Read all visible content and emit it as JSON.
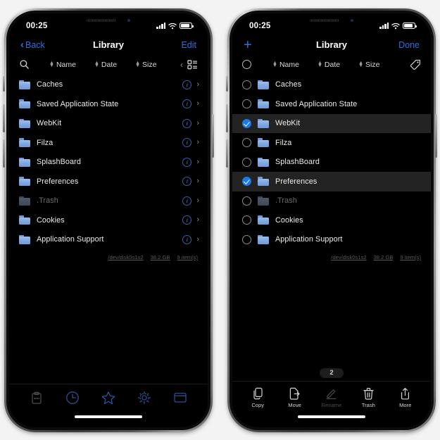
{
  "accent_blue": "#2f6fe0",
  "check_blue": "#1a7ae8",
  "folder_blue": "#7da7e0",
  "phones": [
    {
      "id": "browse-mode",
      "status": {
        "time": "00:25",
        "signal_icon": "cellular-bars-icon",
        "wifi_icon": "wifi-icon",
        "battery_icon": "battery-icon"
      },
      "nav": {
        "back_label": "Back",
        "title": "Library",
        "right_label": "Edit"
      },
      "toolbar": {
        "left_icon": "search-icon",
        "sorts": [
          {
            "label": "Name"
          },
          {
            "label": "Date"
          },
          {
            "label": "Size"
          }
        ],
        "right_chevron_icon": "chevron-left-icon",
        "right_icon": "list-view-icon"
      },
      "files": [
        {
          "name": "Caches",
          "dim": false,
          "selected": false
        },
        {
          "name": "Saved Application State",
          "dim": false,
          "selected": false
        },
        {
          "name": "WebKit",
          "dim": false,
          "selected": false
        },
        {
          "name": "Filza",
          "dim": false,
          "selected": false
        },
        {
          "name": "SplashBoard",
          "dim": false,
          "selected": false
        },
        {
          "name": "Preferences",
          "dim": false,
          "selected": false
        },
        {
          "name": ".Trash",
          "dim": true,
          "selected": false
        },
        {
          "name": "Cookies",
          "dim": false,
          "selected": false
        },
        {
          "name": "Application Support",
          "dim": false,
          "selected": false
        }
      ],
      "meta": {
        "device": "/dev/disk0s1s2",
        "size": "38.2 GB",
        "count": "9 item(s)"
      },
      "tabbar": [
        {
          "icon": "clipboard-icon",
          "name": "tab-clipboard"
        },
        {
          "icon": "clock-icon",
          "name": "tab-recents"
        },
        {
          "icon": "star-icon",
          "name": "tab-favorites"
        },
        {
          "icon": "gear-icon",
          "name": "tab-settings"
        },
        {
          "icon": "window-icon",
          "name": "tab-windows"
        }
      ]
    },
    {
      "id": "edit-mode",
      "status": {
        "time": "00:25",
        "signal_icon": "cellular-bars-icon",
        "wifi_icon": "wifi-icon",
        "battery_icon": "battery-icon"
      },
      "nav": {
        "back_label": "+",
        "title": "Library",
        "right_label": "Done"
      },
      "toolbar": {
        "left_icon": "select-all-circle-icon",
        "sorts": [
          {
            "label": "Name"
          },
          {
            "label": "Date"
          },
          {
            "label": "Size"
          }
        ],
        "right_icon": "tag-icon"
      },
      "files": [
        {
          "name": "Caches",
          "dim": false,
          "selected": false
        },
        {
          "name": "Saved Application State",
          "dim": false,
          "selected": false
        },
        {
          "name": "WebKit",
          "dim": false,
          "selected": true
        },
        {
          "name": "Filza",
          "dim": false,
          "selected": false
        },
        {
          "name": "SplashBoard",
          "dim": false,
          "selected": false
        },
        {
          "name": "Preferences",
          "dim": false,
          "selected": true
        },
        {
          "name": ".Trash",
          "dim": true,
          "selected": false
        },
        {
          "name": "Cookies",
          "dim": false,
          "selected": false
        },
        {
          "name": "Application Support",
          "dim": false,
          "selected": false
        }
      ],
      "meta": {
        "device": "/dev/disk0s1s2",
        "size": "38.2 GB",
        "count": "9 item(s)"
      },
      "selection_badge": "2",
      "actions": [
        {
          "label": "Copy",
          "icon": "copy-icon",
          "disabled": false
        },
        {
          "label": "Move",
          "icon": "move-icon",
          "disabled": false
        },
        {
          "label": "Rename",
          "icon": "rename-pencil-icon",
          "disabled": true
        },
        {
          "label": "Trash",
          "icon": "trash-icon",
          "disabled": false
        },
        {
          "label": "More",
          "icon": "share-more-icon",
          "disabled": false
        }
      ]
    }
  ]
}
